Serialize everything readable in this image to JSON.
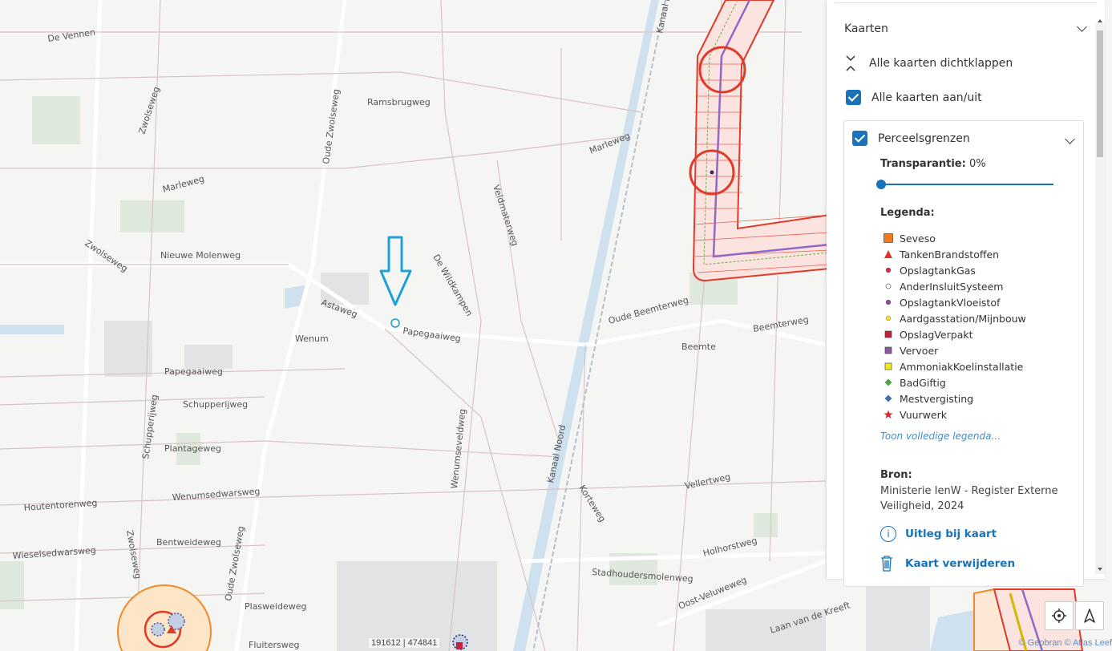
{
  "panel": {
    "title": "Kaarten",
    "collapse_all_label": "Alle kaarten dichtklappen",
    "toggle_all_label": "Alle kaarten aan/uit",
    "layer": {
      "name": "Perceelsgrenzen",
      "transparency_label": "Transparantie:",
      "transparency_value": "0%",
      "transparency": 0.0,
      "legend_title": "Legenda:",
      "legend_items": [
        {
          "label": "Seveso",
          "color": "#f07b1e",
          "shape": "square"
        },
        {
          "label": "TankenBrandstoffen",
          "color": "#e0322c",
          "shape": "triangle"
        },
        {
          "label": "OpslagtankGas",
          "color": "#d8264f",
          "shape": "dot"
        },
        {
          "label": "AnderInsluitSysteem",
          "color": "#ffffff",
          "shape": "dot-outline"
        },
        {
          "label": "OpslagtankVloeistof",
          "color": "#8b4a8f",
          "shape": "dot"
        },
        {
          "label": "Aardgasstation/Mijnbouw",
          "color": "#f3e233",
          "shape": "dot"
        },
        {
          "label": "OpslagVerpakt",
          "color": "#c8203a",
          "shape": "square-small"
        },
        {
          "label": "Vervoer",
          "color": "#8b5a9c",
          "shape": "square-small"
        },
        {
          "label": "AmmoniakKoelinstallatie",
          "color": "#f3e71c",
          "shape": "square-small"
        },
        {
          "label": "BadGiftig",
          "color": "#52a345",
          "shape": "diamond"
        },
        {
          "label": "Mestvergisting",
          "color": "#4a6fa8",
          "shape": "diamond"
        },
        {
          "label": "Vuurwerk",
          "color": "#d42a2a",
          "shape": "star"
        }
      ],
      "show_full_legend": "Toon volledige legenda...",
      "source_title": "Bron:",
      "source_text": "Ministerie IenW - Register Externe Veiligheid, 2024",
      "explain_label": "Uitleg bij kaart",
      "remove_label": "Kaart verwijderen"
    }
  },
  "map": {
    "coordinates": "191612 | 474841",
    "attribution": "© Geobran © Atlas Leef",
    "labels": [
      "De Vennen",
      "Zwolseweg",
      "Ramsbrugweg",
      "Oude Zwolseweg",
      "Marleweg",
      "Marleweg",
      "Veldmaterweg",
      "Zwolseweg",
      "Nieuwe Molenweg",
      "De Wildkampen",
      "Astaweg",
      "Papegaaiweg",
      "Wenum",
      "Oude Beemterweg",
      "Beemterweg",
      "Beemte",
      "Papegaaiweg",
      "Schupperijweg",
      "Schupperijweg",
      "Plantageweg",
      "Wenumseveldweg",
      "Kanaal Noord",
      "Kanaal Noord",
      "Wenumsedwarsweg",
      "Houtentorenweg",
      "Bentweideweg",
      "Zwolseweg",
      "Wieselsedwarsweg",
      "Oude Zwolseweg",
      "Vellertweg",
      "Korteweg",
      "Holhorstweg",
      "Stadhoudersmolenweg",
      "Oost-Veluweweg",
      "Plasweideweg",
      "Fluitersweg",
      "Laan van de Kreeft"
    ]
  }
}
